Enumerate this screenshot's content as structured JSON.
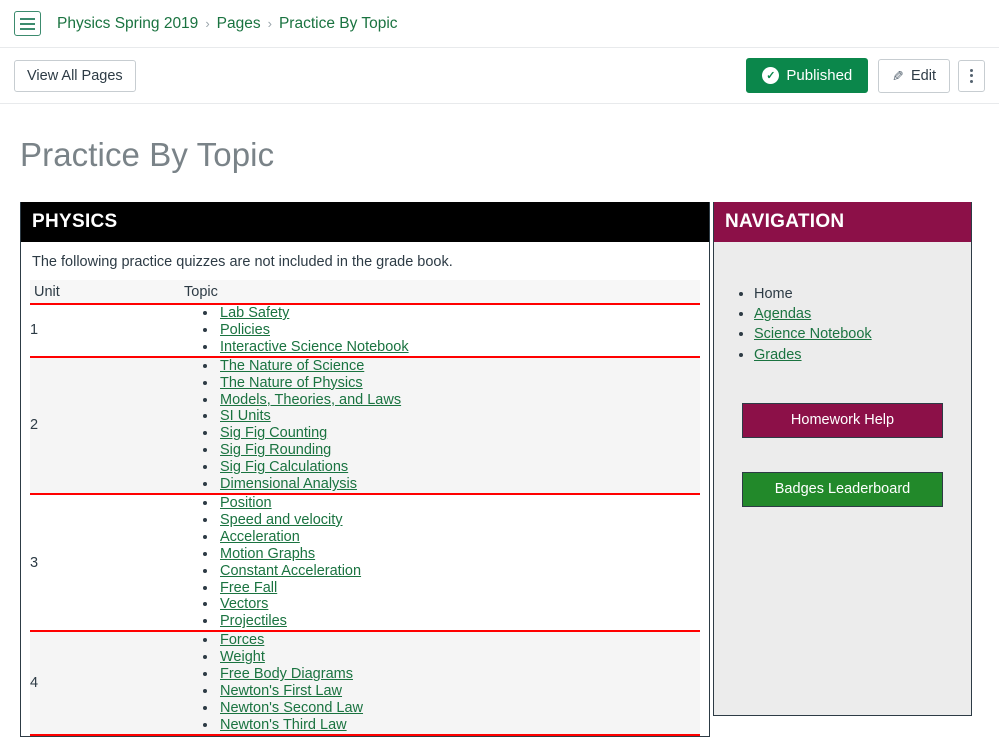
{
  "breadcrumb": {
    "menu_icon": "hamburger-icon",
    "items": [
      {
        "label": "Physics Spring 2019"
      },
      {
        "label": "Pages"
      },
      {
        "label": "Practice By Topic"
      }
    ],
    "separator": "›"
  },
  "toolbar": {
    "view_all_pages_label": "View All Pages",
    "published_label": "Published",
    "published_icon": "check-circle-icon",
    "published_color": "#0b874b",
    "edit_label": "Edit",
    "edit_icon": "pencil-icon",
    "more_icon": "kebab-menu-icon"
  },
  "page": {
    "title": "Practice By Topic"
  },
  "physics_card": {
    "header": "PHYSICS",
    "header_bg": "#000000",
    "note": "The following practice quizzes are not included in the grade book.",
    "columns": [
      "Unit",
      "Topic"
    ],
    "divider_color": "#ff0000",
    "link_color": "#1a7340",
    "rows": [
      {
        "unit": "1",
        "topics": [
          "Lab Safety",
          "Policies",
          "Interactive Science Notebook"
        ]
      },
      {
        "unit": "2",
        "topics": [
          "The Nature of Science",
          "The Nature of Physics",
          "Models, Theories, and Laws",
          "SI Units",
          "Sig Fig Counting",
          "Sig Fig Rounding",
          "Sig Fig Calculations",
          "Dimensional Analysis"
        ]
      },
      {
        "unit": "3",
        "topics": [
          "Position",
          "Speed and velocity",
          "Acceleration",
          "Motion Graphs",
          "Constant Acceleration",
          "Free Fall",
          "Vectors",
          "Projectiles"
        ]
      },
      {
        "unit": "4",
        "topics": [
          "Forces",
          "Weight",
          "Free Body Diagrams",
          "Newton's First Law",
          "Newton's Second Law",
          "Newton's Third Law"
        ]
      }
    ]
  },
  "navigation_card": {
    "header": "NAVIGATION",
    "header_bg": "#8c1048",
    "items": [
      {
        "label": "Home",
        "is_link": false
      },
      {
        "label": "Agendas",
        "is_link": true
      },
      {
        "label": "Science Notebook",
        "is_link": true
      },
      {
        "label": "Grades",
        "is_link": true
      }
    ],
    "buttons": [
      {
        "label": "Homework Help",
        "color": "#8c1048"
      },
      {
        "label": "Badges Leaderboard",
        "color": "#22892a"
      }
    ]
  }
}
